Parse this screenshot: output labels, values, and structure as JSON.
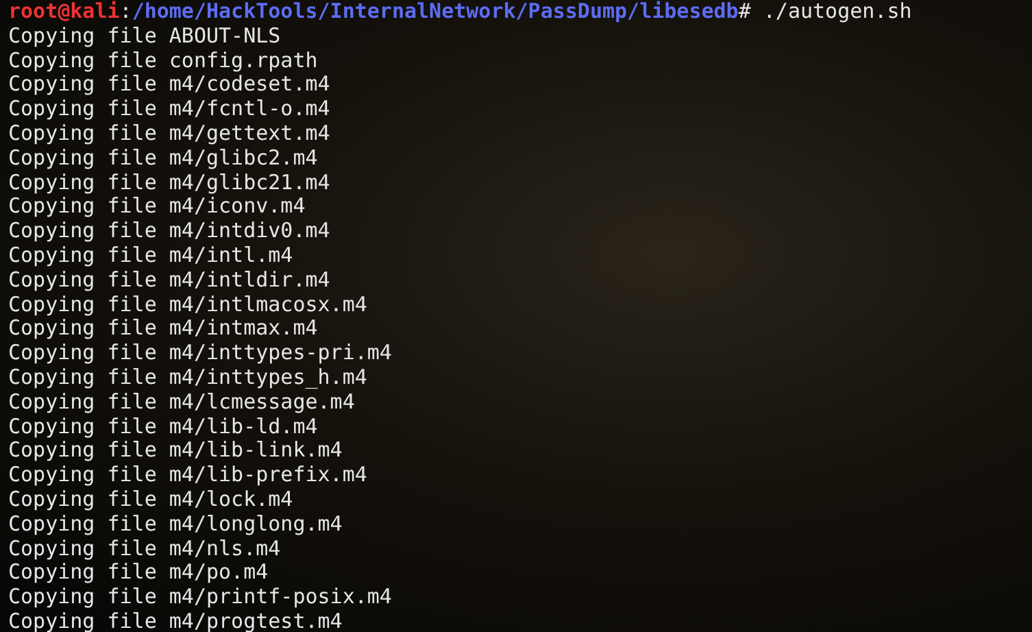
{
  "terminal": {
    "prompt": {
      "user_host": "root@kali",
      "separator": ":",
      "path": "/home/HackTools/InternalNetwork/PassDump/libesedb",
      "command": "# ./autogen.sh"
    },
    "output": [
      "Copying file ABOUT-NLS",
      "Copying file config.rpath",
      "Copying file m4/codeset.m4",
      "Copying file m4/fcntl-o.m4",
      "Copying file m4/gettext.m4",
      "Copying file m4/glibc2.m4",
      "Copying file m4/glibc21.m4",
      "Copying file m4/iconv.m4",
      "Copying file m4/intdiv0.m4",
      "Copying file m4/intl.m4",
      "Copying file m4/intldir.m4",
      "Copying file m4/intlmacosx.m4",
      "Copying file m4/intmax.m4",
      "Copying file m4/inttypes-pri.m4",
      "Copying file m4/inttypes_h.m4",
      "Copying file m4/lcmessage.m4",
      "Copying file m4/lib-ld.m4",
      "Copying file m4/lib-link.m4",
      "Copying file m4/lib-prefix.m4",
      "Copying file m4/lock.m4",
      "Copying file m4/longlong.m4",
      "Copying file m4/nls.m4",
      "Copying file m4/po.m4",
      "Copying file m4/printf-posix.m4",
      "Copying file m4/progtest.m4"
    ]
  }
}
